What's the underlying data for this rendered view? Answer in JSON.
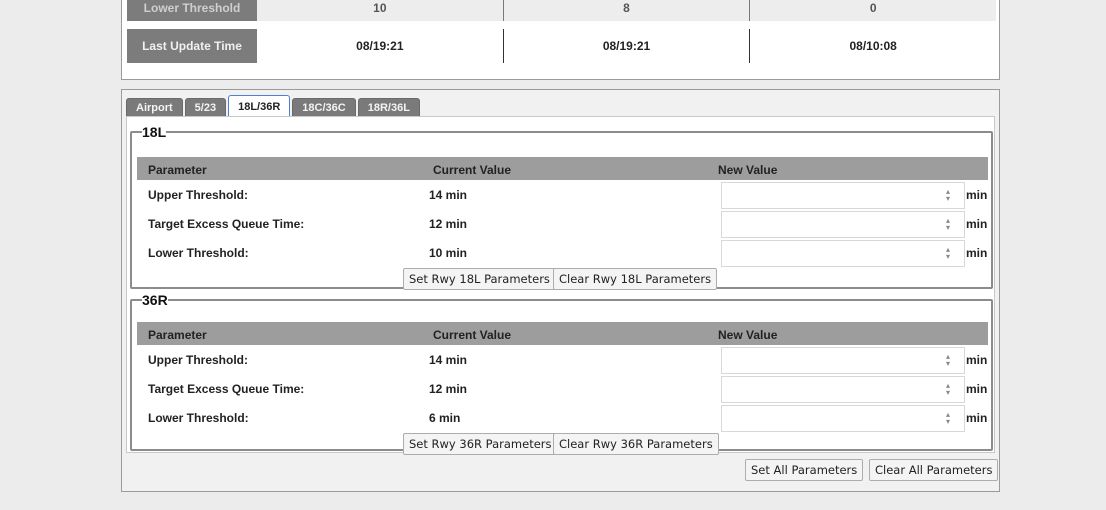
{
  "summary": {
    "rows": [
      {
        "label": "Lower Threshold",
        "values": [
          "10",
          "8",
          "0"
        ]
      },
      {
        "label": "Last Update Time",
        "values": [
          "08/19:21",
          "08/19:21",
          "08/10:08"
        ]
      }
    ]
  },
  "tabs": [
    {
      "label": "Airport",
      "active": false
    },
    {
      "label": "5/23",
      "active": false
    },
    {
      "label": "18L/36R",
      "active": true
    },
    {
      "label": "18C/36C",
      "active": false
    },
    {
      "label": "18R/36L",
      "active": false
    }
  ],
  "runways": [
    {
      "legend": "18L",
      "headers": {
        "parameter": "Parameter",
        "current": "Current Value",
        "new": "New Value"
      },
      "params": [
        {
          "name": "Upper Threshold:",
          "current": "14 min",
          "new_value": "",
          "unit": "min"
        },
        {
          "name": "Target Excess Queue Time:",
          "current": "12 min",
          "new_value": "",
          "unit": "min"
        },
        {
          "name": "Lower Threshold:",
          "current": "10 min",
          "new_value": "",
          "unit": "min"
        }
      ],
      "set_button": "Set Rwy 18L Parameters",
      "clear_button": "Clear Rwy 18L Parameters"
    },
    {
      "legend": "36R",
      "headers": {
        "parameter": "Parameter",
        "current": "Current Value",
        "new": "New Value"
      },
      "params": [
        {
          "name": "Upper Threshold:",
          "current": "14 min",
          "new_value": "",
          "unit": "min"
        },
        {
          "name": "Target Excess Queue Time:",
          "current": "12 min",
          "new_value": "",
          "unit": "min"
        },
        {
          "name": "Lower Threshold:",
          "current": "6 min",
          "new_value": "",
          "unit": "min"
        }
      ],
      "set_button": "Set Rwy 36R Parameters",
      "clear_button": "Clear Rwy 36R Parameters"
    }
  ],
  "footer": {
    "set_all": "Set All Parameters",
    "clear_all": "Clear All Parameters"
  },
  "icons": {
    "spinner": "up-down-arrows-icon"
  },
  "colors": {
    "tab_inactive": "#7a7a7a",
    "tab_active_border": "#4d7fd4",
    "grid_header": "#9d9d9d",
    "label_cell": "#7c7c7c"
  }
}
